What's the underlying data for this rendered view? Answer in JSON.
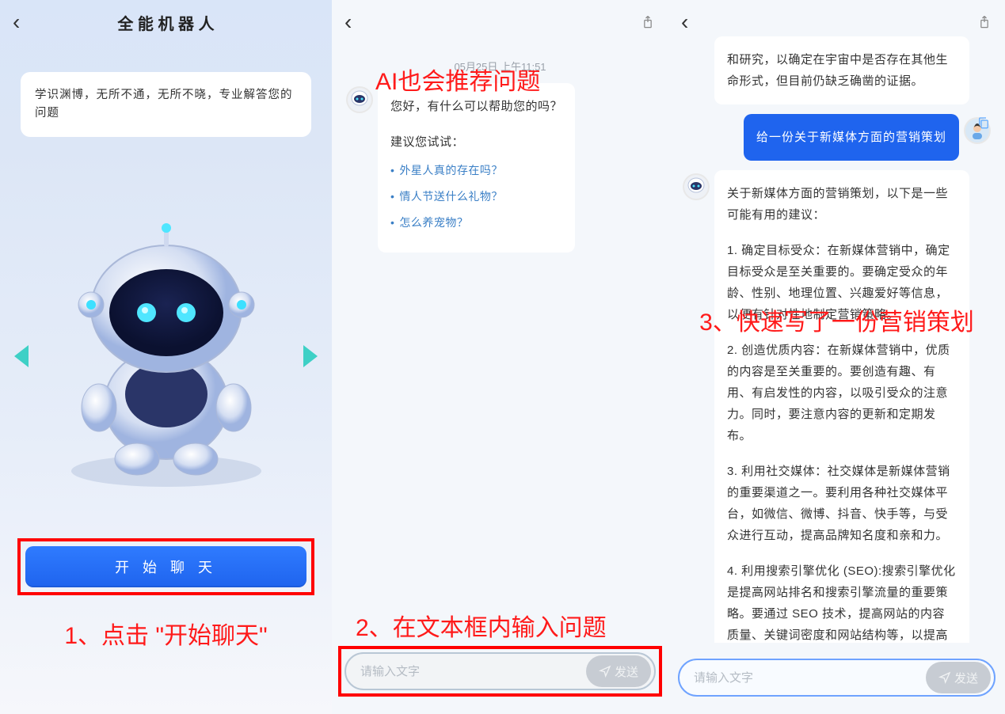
{
  "panel1": {
    "title": "全 能 机 器 人",
    "intro": "学识渊博，无所不通，无所不晓，专业解答您的问题",
    "start_label": "开 始 聊 天",
    "annotation": "1、点击 \"开始聊天\""
  },
  "panel2": {
    "timestamp": "05月25日  上午11:51",
    "annotation_top": "AI也会推荐问题",
    "greeting": "您好，有什么可以帮助您的吗？",
    "suggest_title": "建议您试试：",
    "suggestions": [
      "外星人真的存在吗？",
      "情人节送什么礼物？",
      "怎么养宠物？"
    ],
    "annotation_bottom": "2、在文本框内输入问题",
    "input_placeholder": "请输入文字",
    "send_label": "发送"
  },
  "panel3": {
    "msg_top_fragment": "和研究，以确定在宇宙中是否存在其他生命形式，但目前仍缺乏确凿的证据。",
    "user_msg": "给一份关于新媒体方面的营销策划",
    "annotation": "3、快速写了一份营销策划",
    "reply_intro": "关于新媒体方面的营销策划，以下是一些可能有用的建议：",
    "reply_items": [
      "1. 确定目标受众：在新媒体营销中，确定目标受众是至关重要的。要确定受众的年龄、性别、地理位置、兴趣爱好等信息，以便有针对性地制定营销策略。",
      "2. 创造优质内容：在新媒体营销中，优质的内容是至关重要的。要创造有趣、有用、有启发性的内容，以吸引受众的注意力。同时，要注意内容的更新和定期发布。",
      "3. 利用社交媒体：社交媒体是新媒体营销的重要渠道之一。要利用各种社交媒体平台，如微信、微博、抖音、快手等，与受众进行互动，提高品牌知名度和亲和力。",
      "4. 利用搜索引擎优化 (SEO):搜索引擎优化是提高网站排名和搜索引擎流量的重要策略。要通过 SEO 技术，提高网站的内容质量、关键词密度和网站结构等，以提高网站的排名和流量。"
    ],
    "input_placeholder": "请输入文字",
    "send_label": "发送"
  }
}
